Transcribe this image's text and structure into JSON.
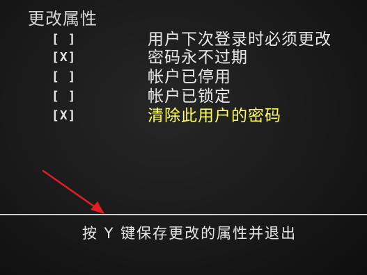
{
  "section_title": "更改属性",
  "options": [
    {
      "checkbox": "[ ]",
      "label": "用户下次登录时必须更改",
      "checked": false,
      "selected": false
    },
    {
      "checkbox": "[X]",
      "label": "密码永不过期",
      "checked": true,
      "selected": false
    },
    {
      "checkbox": "[ ]",
      "label": "帐户已停用",
      "checked": false,
      "selected": false
    },
    {
      "checkbox": "[ ]",
      "label": "帐户已锁定",
      "checked": false,
      "selected": false
    },
    {
      "checkbox": "[X]",
      "label": "清除此用户的密码",
      "checked": true,
      "selected": true
    }
  ],
  "footer": {
    "hint": "按 Y 键保存更改的属性并退出"
  },
  "colors": {
    "background": "#1a1a1a",
    "text": "#e6e6e6",
    "selected_text": "#ffff55",
    "arrow": "#e02020"
  },
  "annotation": {
    "type": "arrow",
    "icon": "red-arrow-icon"
  }
}
